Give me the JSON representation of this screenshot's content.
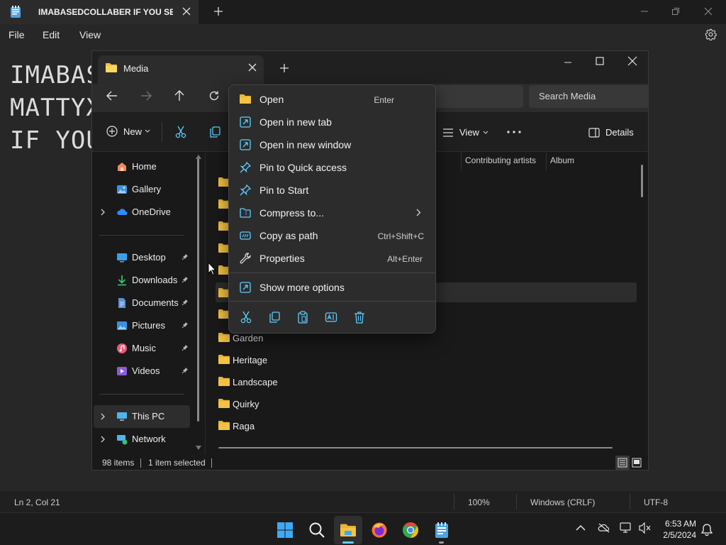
{
  "notepad": {
    "tab_title": "IMABASEDCOLLABER IF YOU SEE T",
    "menu": [
      "File",
      "Edit",
      "View"
    ],
    "lines": [
      "IMABAS",
      "MATTYX",
      "IF YOU"
    ],
    "status": {
      "position": "Ln 2, Col 21",
      "zoom": "100%",
      "line_ending": "Windows (CRLF)",
      "encoding": "UTF-8"
    }
  },
  "explorer": {
    "tab_title": "Media",
    "search_placeholder": "Search Media",
    "toolbar": {
      "new_label": "New",
      "view_label": "View",
      "details_label": "Details"
    },
    "columns": [
      "Contributing artists",
      "Album"
    ],
    "sidebar": {
      "top": [
        {
          "label": "Home",
          "icon": "home-icon"
        },
        {
          "label": "Gallery",
          "icon": "gallery-icon"
        },
        {
          "label": "OneDrive",
          "icon": "onedrive-icon"
        }
      ],
      "quick": [
        {
          "label": "Desktop",
          "icon": "desktop-icon"
        },
        {
          "label": "Downloads",
          "icon": "downloads-icon"
        },
        {
          "label": "Documents",
          "icon": "documents-icon"
        },
        {
          "label": "Pictures",
          "icon": "pictures-icon"
        },
        {
          "label": "Music",
          "icon": "music-icon"
        },
        {
          "label": "Videos",
          "icon": "videos-icon"
        }
      ],
      "bottom": [
        {
          "label": "This PC",
          "icon": "pc-icon"
        },
        {
          "label": "Network",
          "icon": "network-icon"
        }
      ]
    },
    "files": [
      "Garden",
      "Heritage",
      "Landscape",
      "Quirky",
      "Raga"
    ],
    "status": {
      "count": "98 items",
      "selected": "1 item selected"
    }
  },
  "context_menu": {
    "items": [
      {
        "label": "Open",
        "shortcut": "Enter",
        "icon": "folder-open-icon"
      },
      {
        "label": "Open in new tab",
        "shortcut": "",
        "icon": "new-tab-icon"
      },
      {
        "label": "Open in new window",
        "shortcut": "",
        "icon": "new-window-icon"
      },
      {
        "label": "Pin to Quick access",
        "shortcut": "",
        "icon": "pin-icon"
      },
      {
        "label": "Pin to Start",
        "shortcut": "",
        "icon": "pin-icon"
      },
      {
        "label": "Compress to...",
        "shortcut": "",
        "icon": "zip-icon"
      },
      {
        "label": "Copy as path",
        "shortcut": "Ctrl+Shift+C",
        "icon": "copy-path-icon"
      },
      {
        "label": "Properties",
        "shortcut": "Alt+Enter",
        "icon": "wrench-icon"
      }
    ],
    "more_label": "Show more options"
  },
  "taskbar": {
    "time": "6:53 AM",
    "date": "2/5/2024"
  },
  "colors": {
    "accent": "#60cdff",
    "folder": "#f5c342",
    "selection": "#2d2d2d"
  }
}
